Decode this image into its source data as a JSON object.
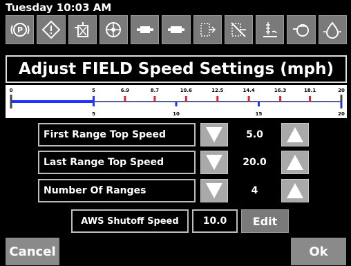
{
  "status": {
    "time": "Tuesday 10:03 AM"
  },
  "icon_bar": {
    "icons": [
      "parking-brake-icon",
      "master-warning-icon",
      "hydraulic-filter-icon",
      "engine-fan-icon",
      "engine-icon",
      "engine-warning-icon",
      "transmission-icon",
      "transmission-fault-icon",
      "fuel-level-icon",
      "coolant-icon",
      "oil-pressure-icon"
    ]
  },
  "title": "Adjust FIELD Speed Settings (mph)",
  "speed_scale": {
    "min": 0,
    "max": 20,
    "top_ticks": [
      "0",
      "5",
      "6.9",
      "8.7",
      "10.6",
      "12.5",
      "14.4",
      "16.3",
      "18.1",
      "20"
    ],
    "bottom_ticks": [
      "5",
      "10",
      "15",
      "20"
    ],
    "first_range_top": 5.0,
    "colors": {
      "range": "#2233ff",
      "marker": "#e0232b",
      "axis": "#1a2a6b"
    }
  },
  "settings": [
    {
      "label": "First Range Top Speed",
      "value": "5.0"
    },
    {
      "label": "Last Range Top Speed",
      "value": "20.0"
    },
    {
      "label": "Number Of Ranges",
      "value": "4"
    }
  ],
  "aws": {
    "label": "AWS Shutoff Speed",
    "value": "10.0",
    "edit_label": "Edit"
  },
  "footer": {
    "cancel_label": "Cancel",
    "ok_label": "Ok"
  }
}
